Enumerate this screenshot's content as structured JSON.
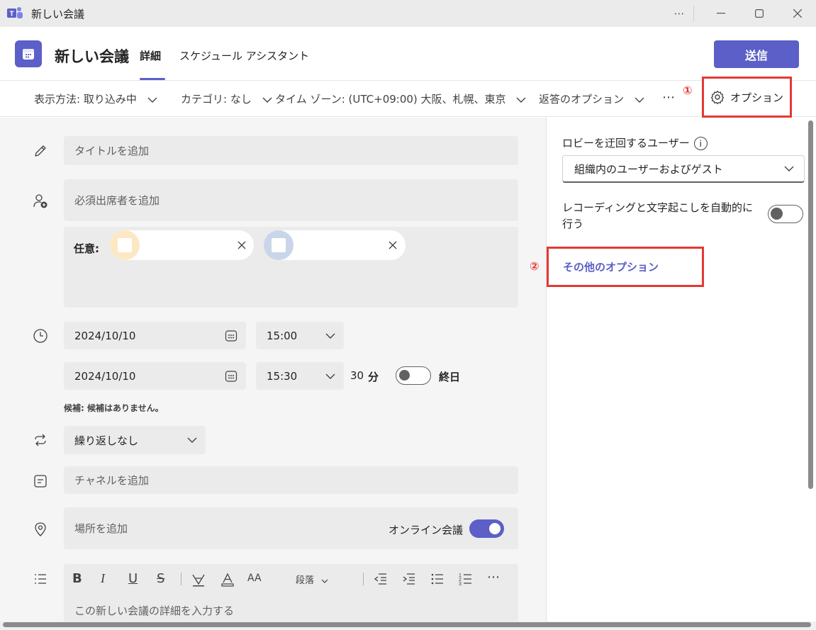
{
  "window": {
    "title": "新しい会議",
    "more_label": "⋯"
  },
  "header": {
    "meeting_title": "新しい会議",
    "tabs": [
      {
        "label": "詳細",
        "active": true
      },
      {
        "label": "スケジュール アシスタント",
        "active": false
      }
    ],
    "send_label": "送信",
    "accent_color": "#5b5fc7"
  },
  "toolbar": {
    "show_as": "表示方法: 取り込み中",
    "category": "カテゴリ: なし",
    "timezone": "タイム ゾーン: (UTC+09:00) 大阪、札幌、東京",
    "response": "返答のオプション",
    "more": "⋯",
    "options_label": "オプション",
    "marker_1": "①"
  },
  "form": {
    "title_placeholder": "タイトルを追加",
    "attendees_placeholder": "必須出席者を追加",
    "optional_label": "任意:",
    "start_date": "2024/10/10",
    "start_time": "15:00",
    "end_date": "2024/10/10",
    "end_time": "15:30",
    "duration_value": "30",
    "duration_unit": "分",
    "all_day_label": "終日",
    "suggestion": "候補: 候補はありません。",
    "repeat": "繰り返しなし",
    "channel_placeholder": "チャネルを追加",
    "location_placeholder": "場所を追加",
    "online_label": "オンライン会議",
    "online_on": true,
    "paragraph_label": "段落",
    "details_placeholder": "この新しい会議の詳細を入力する"
  },
  "options_panel": {
    "lobby_label": "ロビーを迂回するユーザー",
    "lobby_value": "組織内のユーザーおよびゲスト",
    "record_label_line1": "レコーディングと文字起こしを自動的に",
    "record_label_line2": "行う",
    "record_on": false,
    "more_options_label": "その他のオプション",
    "marker_2": "②"
  },
  "colors": {
    "highlight_red": "#e53935",
    "chip1_avatar": "#fde8c4",
    "chip2_avatar": "#c9d6ea"
  }
}
